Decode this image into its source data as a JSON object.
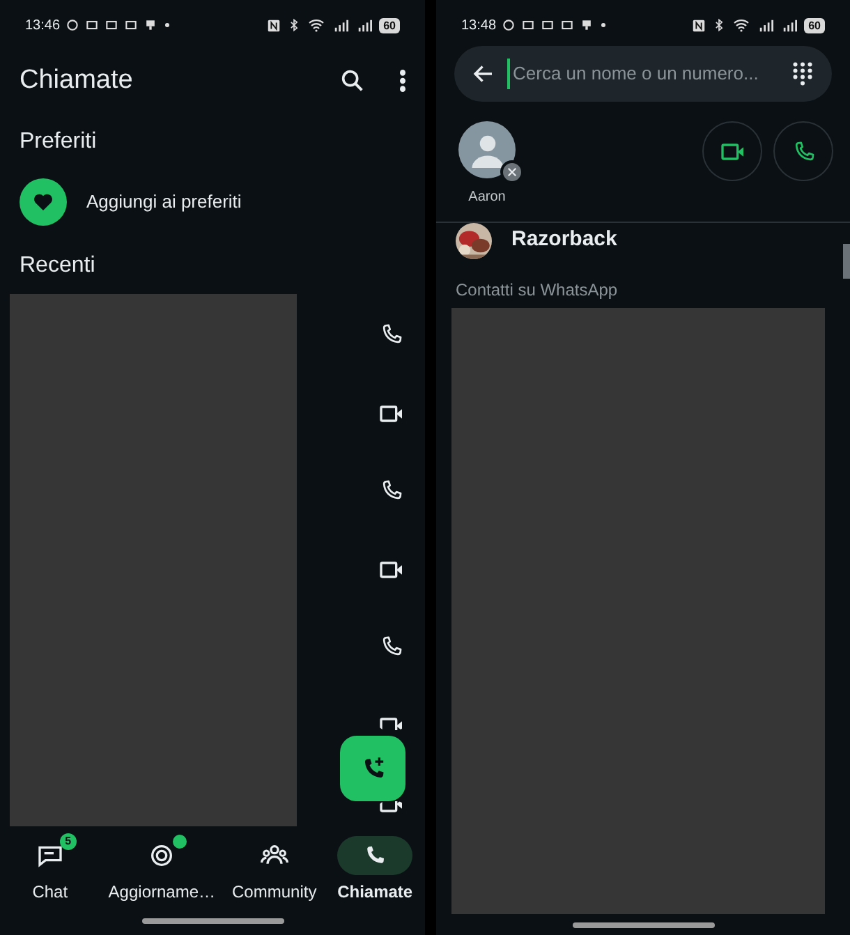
{
  "calls_screen": {
    "status_bar": {
      "time": "13:46",
      "battery": "60"
    },
    "title": "Chiamate",
    "favorites_heading": "Preferiti",
    "add_favorite": "Aggiungi ai preferiti",
    "recent_heading": "Recenti",
    "recent_calls": [
      {
        "kind": "voice",
        "cut_bottom": false,
        "cut_top": false
      },
      {
        "kind": "video",
        "cut_bottom": false,
        "cut_top": false
      },
      {
        "kind": "voice",
        "cut_bottom": false,
        "cut_top": false
      },
      {
        "kind": "video",
        "cut_bottom": false,
        "cut_top": false
      },
      {
        "kind": "voice",
        "cut_bottom": false,
        "cut_top": false
      },
      {
        "kind": "video",
        "cut_bottom": true,
        "cut_top": false
      },
      {
        "kind": "video",
        "cut_bottom": false,
        "cut_top": true
      }
    ],
    "bottom_nav": [
      {
        "kind": "chat",
        "label": "Chat",
        "badge": "5",
        "dot": false,
        "selected": false
      },
      {
        "kind": "updates",
        "label": "Aggiorname…",
        "dot": true,
        "selected": false
      },
      {
        "kind": "community",
        "label": "Community",
        "dot": false,
        "selected": false
      },
      {
        "kind": "calls",
        "label": "Chiamate",
        "dot": false,
        "selected": true
      }
    ]
  },
  "new_call_screen": {
    "status_bar": {
      "time": "13:48",
      "battery": "60"
    },
    "search": {
      "placeholder": "Cerca un nome o un numero..."
    },
    "selected_contacts": [
      {
        "name": "Aaron"
      }
    ],
    "contacts": [
      {
        "name": "Razorback"
      }
    ],
    "whatsapp_heading": "Contatti su WhatsApp"
  }
}
